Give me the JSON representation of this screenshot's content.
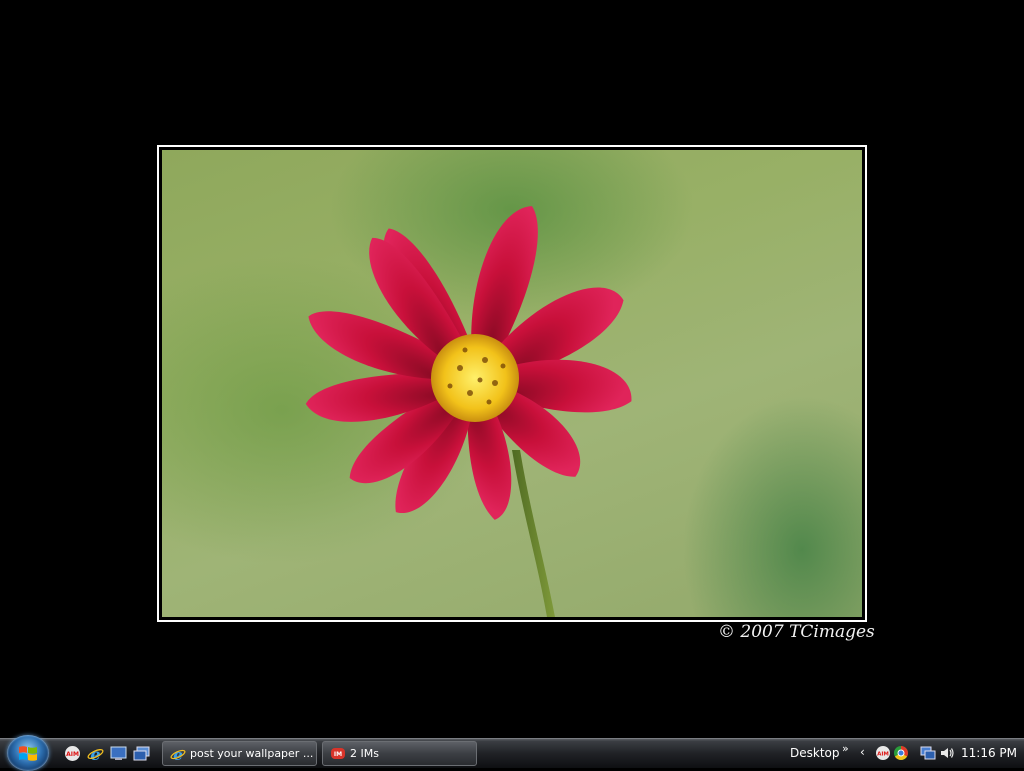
{
  "wallpaper": {
    "watermark_text": "© 2007 TCimages"
  },
  "taskbar": {
    "start_button_icon": "windows-logo-icon",
    "quick_launch": [
      {
        "icon": "aim-icon"
      },
      {
        "icon": "internet-explorer-icon"
      },
      {
        "icon": "show-desktop-icon"
      },
      {
        "icon": "switch-windows-icon"
      }
    ],
    "tasks": [
      {
        "icon": "internet-explorer-icon",
        "label": "post your wallpaper ..."
      },
      {
        "icon": "aim-im-icon",
        "label": "2 IMs"
      }
    ],
    "toolbar_label": "Desktop",
    "toolbar_chevron": "»",
    "tray_expand": "‹",
    "tray_icons": [
      "aim-tray-icon",
      "chrome-like-icon",
      "network-icon",
      "volume-icon"
    ],
    "clock": "11:16 PM"
  },
  "colors": {
    "desktop_background": "#000000",
    "flower": "#c8103a",
    "flower_center": "#f2c21a"
  }
}
